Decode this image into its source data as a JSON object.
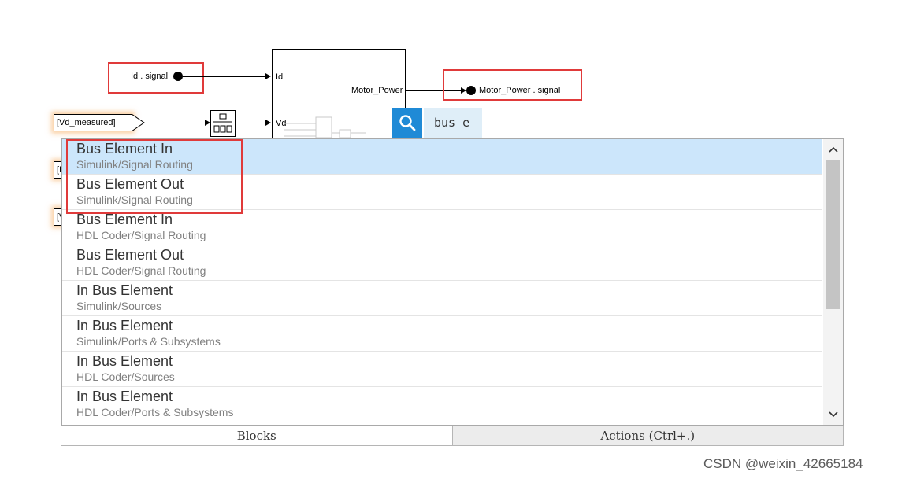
{
  "canvas": {
    "signals": {
      "id_signal": "Id . signal",
      "motor_power_signal": "Motor_Power . signal",
      "vd_measured": "[Vd_measured]",
      "goto_tag_2": "[I",
      "goto_tag_3": "[V"
    },
    "subsystem": {
      "port_id": "Id",
      "port_vd": "Vd",
      "port_motor_power": "Motor_Power"
    }
  },
  "search": {
    "query": "bus e",
    "icon": "search-icon"
  },
  "results": [
    {
      "title": "Bus Element In",
      "path": "Simulink/Signal Routing",
      "selected": true
    },
    {
      "title": "Bus Element Out",
      "path": "Simulink/Signal Routing",
      "selected": false
    },
    {
      "title": "Bus Element In",
      "path": "HDL Coder/Signal Routing",
      "selected": false
    },
    {
      "title": "Bus Element Out",
      "path": "HDL Coder/Signal Routing",
      "selected": false
    },
    {
      "title": "In Bus Element",
      "path": "Simulink/Sources",
      "selected": false
    },
    {
      "title": "In Bus Element",
      "path": "Simulink/Ports & Subsystems",
      "selected": false
    },
    {
      "title": "In Bus Element",
      "path": "HDL Coder/Sources",
      "selected": false
    },
    {
      "title": "In Bus Element",
      "path": "HDL Coder/Ports & Subsystems",
      "selected": false
    }
  ],
  "tabs": {
    "blocks": "Blocks",
    "actions": "Actions (Ctrl+.)"
  },
  "watermark": "CSDN @weixin_42665184",
  "colors": {
    "highlight_red": "#e03a3a",
    "search_blue": "#1f8ad6",
    "selected_row": "#cce6fb"
  }
}
